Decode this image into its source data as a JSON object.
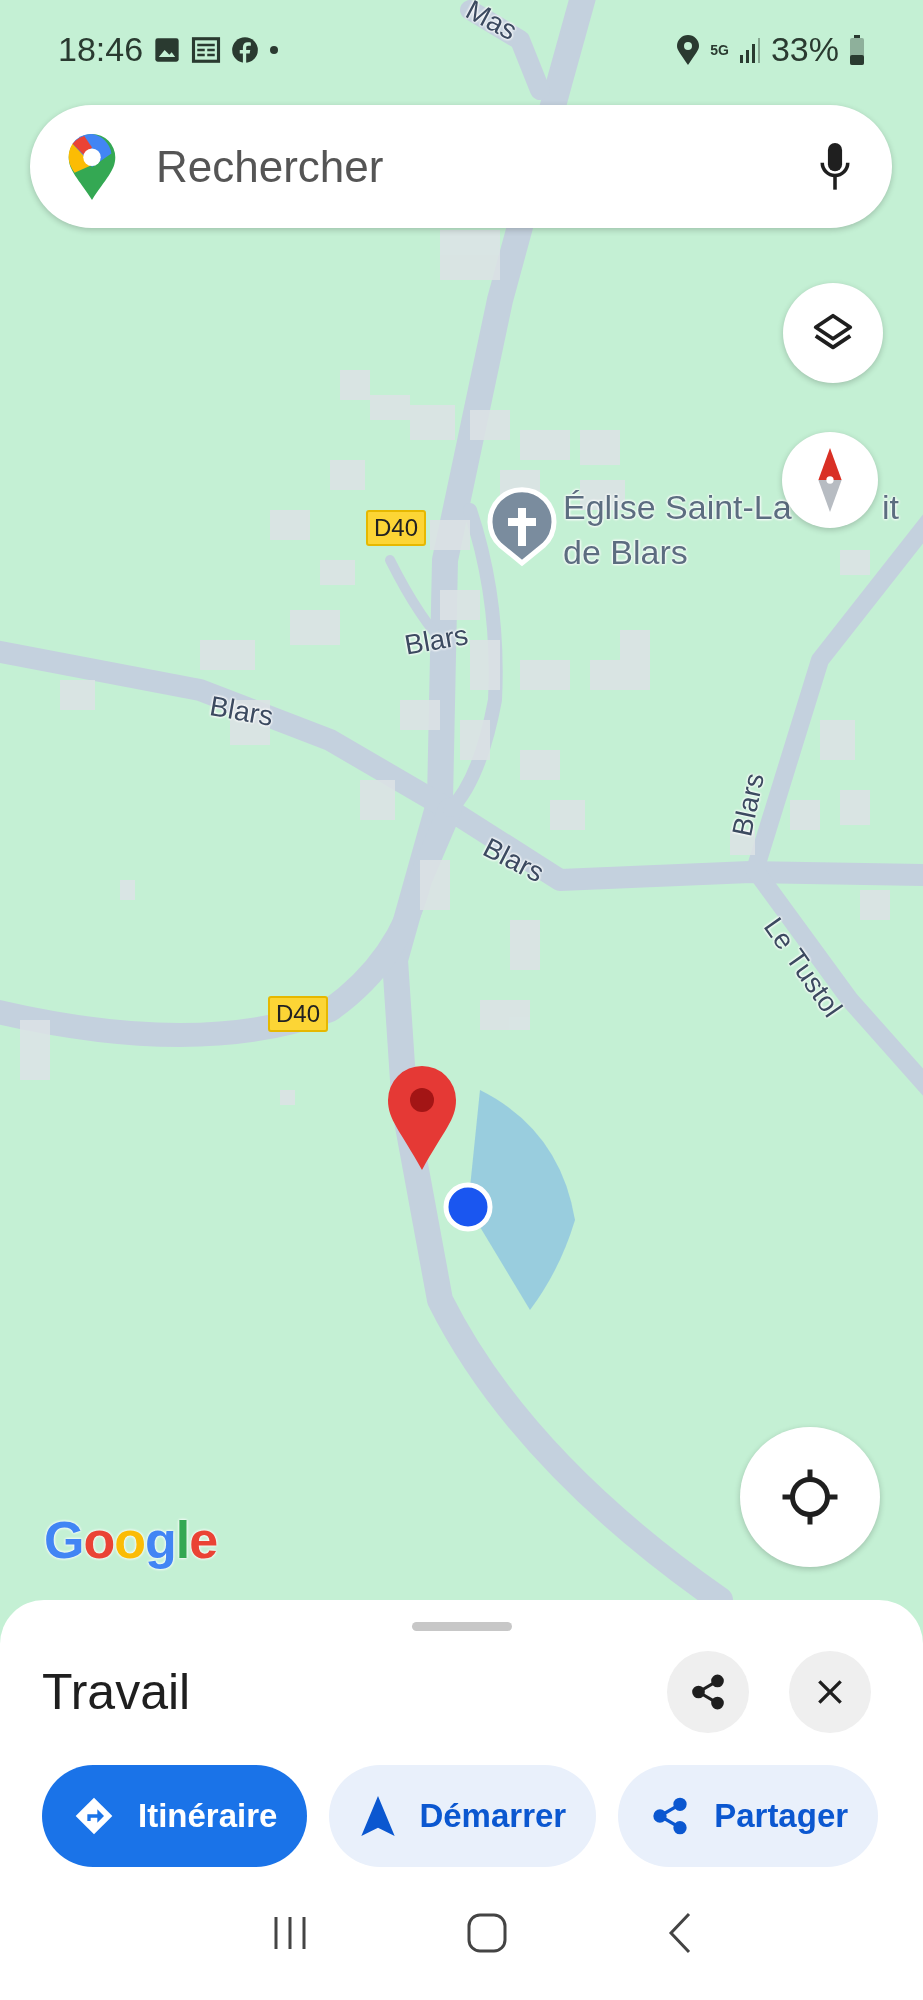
{
  "status_bar": {
    "time": "18:46",
    "network": "5G",
    "battery": "33%"
  },
  "search": {
    "placeholder": "Rechercher"
  },
  "map": {
    "labels": [
      {
        "kind": "road",
        "text": "Mas"
      },
      {
        "kind": "poi",
        "text": "Église Saint-La"
      },
      {
        "kind": "poi_part",
        "text": "it"
      },
      {
        "kind": "poi_part",
        "text": "de Blars"
      },
      {
        "kind": "route",
        "text": "D40"
      },
      {
        "kind": "road",
        "text": "Blars"
      },
      {
        "kind": "road",
        "text": "Blars"
      },
      {
        "kind": "road",
        "text": "Blars"
      },
      {
        "kind": "road",
        "text": "Blars"
      },
      {
        "kind": "road",
        "text": "Le Tustol"
      },
      {
        "kind": "route",
        "text": "D40"
      }
    ],
    "attribution": "Google"
  },
  "place_sheet": {
    "title": "Travail",
    "actions": [
      {
        "kind": "primary",
        "label": "Itinéraire"
      },
      {
        "kind": "secondary",
        "label": "Démarrer"
      },
      {
        "kind": "share",
        "label": "Partager"
      }
    ]
  }
}
